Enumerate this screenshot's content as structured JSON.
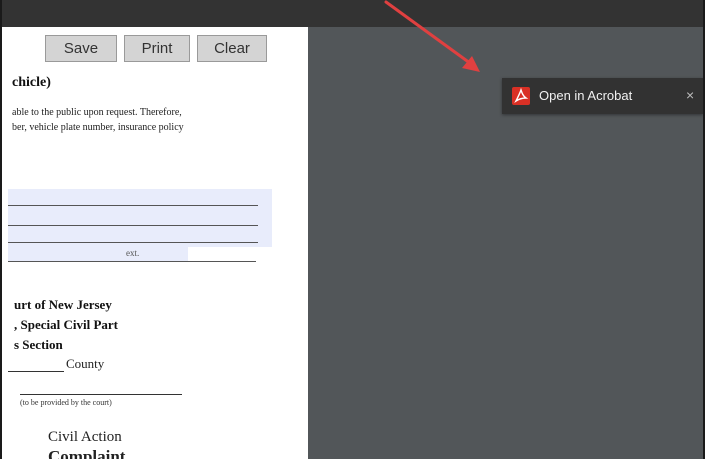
{
  "form": {
    "buttons": {
      "save": "Save",
      "print": "Print",
      "clear": "Clear"
    },
    "heading": "chicle)",
    "paragraph": [
      "able to the public upon request.  Therefore,",
      "ber, vehicle plate number, insurance policy"
    ],
    "ext_label": "ext.",
    "court": [
      "urt of New Jersey",
      ", Special Civil Part",
      "s Section"
    ],
    "county": "County",
    "provided_note": "(to be provided by the court)",
    "civil_action": "Civil Action",
    "complaint": "Complaint"
  },
  "toast": {
    "label": "Open in Acrobat",
    "close": "×",
    "icon": "acrobat-pdf-icon"
  },
  "annotation": {
    "arrow_color": "#e04040"
  },
  "colors": {
    "topbar": "#333333",
    "viewer_bg": "#525659",
    "toast_bg": "#323232",
    "field_fill": "#e8ecfb",
    "acrobat_red": "#d93025"
  }
}
